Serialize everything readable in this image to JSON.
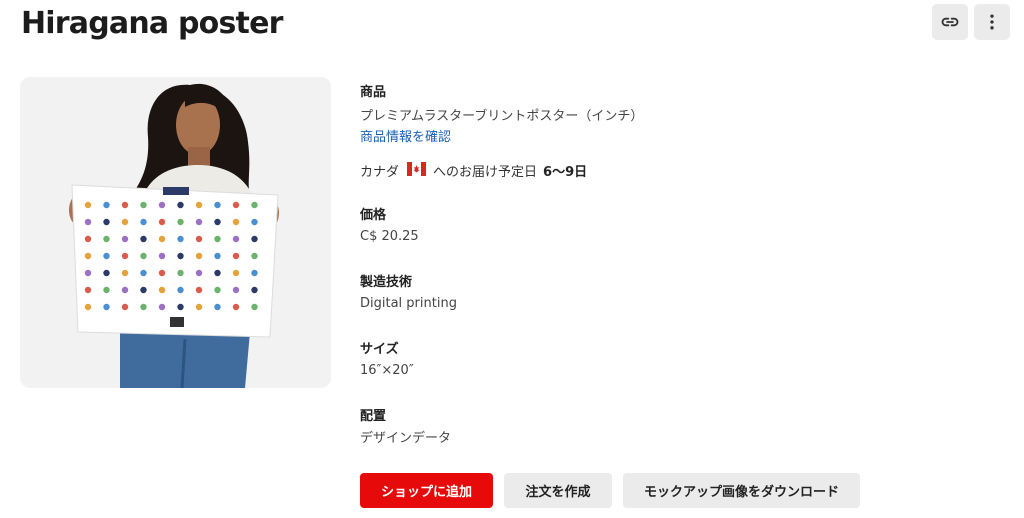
{
  "title": "Hiragana poster",
  "icons": {
    "link": "link-icon",
    "more": "more-vertical-icon"
  },
  "product": {
    "label": "商品",
    "name": "プレミアムラスターブリントポスター（インチ）",
    "info_link": "商品情報を確認"
  },
  "delivery": {
    "country": "カナダ",
    "text": "へのお届け予定日",
    "days": "6〜9日"
  },
  "price": {
    "label": "価格",
    "value": "C$ 20.25"
  },
  "technique": {
    "label": "製造技術",
    "value": "Digital printing"
  },
  "size": {
    "label": "サイズ",
    "value": "16″×20″"
  },
  "placement": {
    "label": "配置",
    "value": "デザインデータ"
  },
  "buttons": {
    "add_to_shop": "ショップに追加",
    "create_order": "注文を作成",
    "download_mockup": "モックアップ画像をダウンロード"
  },
  "colors": {
    "primary": "#e60a0a",
    "link": "#1a5fb4",
    "button_bg": "#ebebeb"
  }
}
